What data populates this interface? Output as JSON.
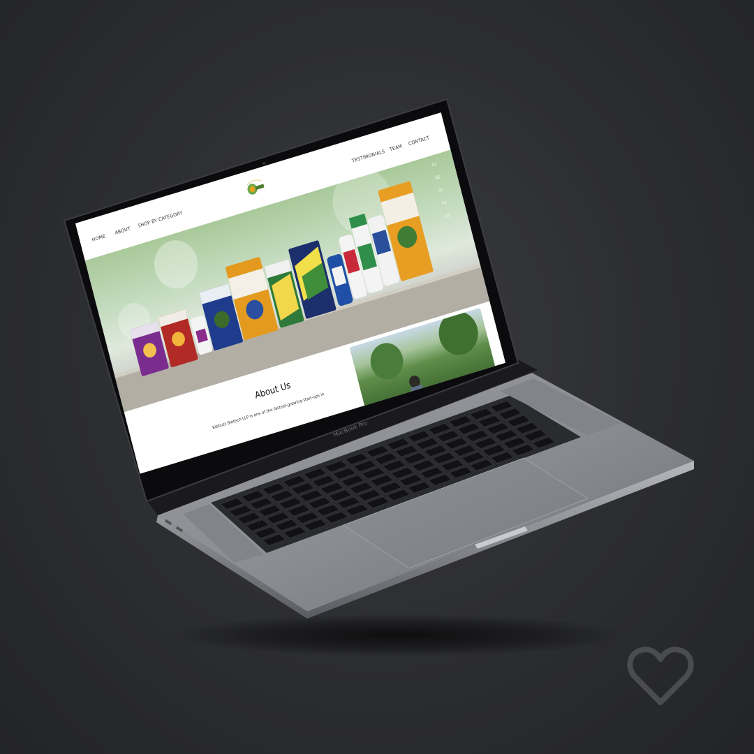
{
  "colors": {
    "background": "#2c2d30",
    "laptop_body": "#8a8c92",
    "bezel": "#0d0d0f",
    "site_bg": "#ffffff",
    "accent_green": "#6aa84f"
  },
  "site": {
    "nav": {
      "home": "HOME",
      "about": "ABOUT",
      "shop_by_category": "SHOP BY CATEGORY",
      "testimonials": "TESTIMONIALS",
      "team": "TEAM",
      "contact": "CONTACT"
    },
    "logo_icon": "kibbutz-logo",
    "slider": {
      "numbers": [
        "01",
        "02",
        "03",
        "04",
        "05"
      ],
      "active": "02"
    },
    "about": {
      "title": "About Us",
      "text": "Kibbutz Biotech LLP is one of the fastest-growing start-ups in"
    }
  },
  "device": {
    "model_label": "MacBook Pro"
  },
  "like_icon": "heart-icon"
}
